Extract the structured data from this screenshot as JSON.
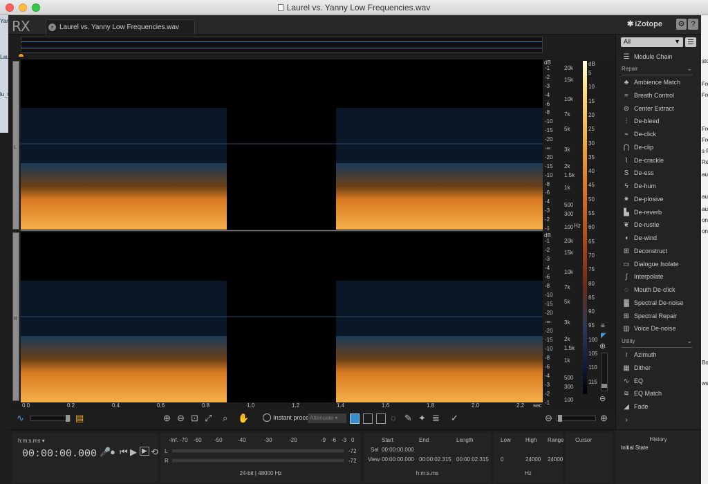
{
  "window": {
    "title": "Laurel vs. Yanny Low Frequencies.wav"
  },
  "app": {
    "logo": "RX",
    "brand": "iZotope",
    "file_tab": "Laurel vs. Yanny Low Frequencies.wav",
    "settings_icon": "gear-icon",
    "help_label": "?"
  },
  "left_strip": [
    "Yan",
    "Lau",
    "lu_wa"
  ],
  "right_strip": [
    "sto",
    "Fre",
    "Fre",
    "Fre",
    "Fre",
    "s R",
    "Re",
    "aur",
    "aur",
    "aur",
    "ony",
    "ony",
    "Bo",
    "ws"
  ],
  "channels": [
    "L",
    "R"
  ],
  "freq_axis": {
    "db_header": "dB",
    "hz_label": "Hz",
    "top": {
      "db": [
        "-1",
        "-2",
        "-3",
        "-4",
        "-6",
        "-8",
        "-10",
        "-15",
        "-20",
        "-∞",
        "-20",
        "-15",
        "-10",
        "-8",
        "-6",
        "-4",
        "-3",
        "-2",
        "-1"
      ],
      "hz": [
        "20k",
        "15k",
        "10k",
        "7k",
        "5k",
        "3k",
        "2k",
        "1.5k",
        "1k",
        "500",
        "300",
        "100"
      ]
    },
    "bottom": {
      "db": [
        "-1",
        "-2",
        "-3",
        "-4",
        "-6",
        "-8",
        "-10",
        "-15",
        "-20",
        "-∞",
        "-20",
        "-15",
        "-10",
        "-8",
        "-6",
        "-4",
        "-3",
        "-2",
        "-1"
      ],
      "hz": [
        "20k",
        "15k",
        "10k",
        "7k",
        "5k",
        "3k",
        "2k",
        "1.5k",
        "1k",
        "500",
        "300",
        "100"
      ]
    }
  },
  "db_scale": {
    "header": "dB",
    "values": [
      "5",
      "10",
      "15",
      "20",
      "25",
      "30",
      "35",
      "40",
      "45",
      "50",
      "55",
      "60",
      "65",
      "70",
      "75",
      "80",
      "85",
      "90",
      "95",
      "100",
      "105",
      "110",
      "115"
    ]
  },
  "time_axis": {
    "unit": "sec",
    "ticks": [
      "0.0",
      "0.2",
      "0.4",
      "0.6",
      "0.8",
      "1.0",
      "1.2",
      "1.4",
      "1.6",
      "1.8",
      "2.0",
      "2.2"
    ]
  },
  "modules": {
    "filter": "All",
    "module_chain": "Module Chain",
    "repair_label": "Repair",
    "repair": [
      {
        "label": "Ambience Match",
        "icon": "tree-icon"
      },
      {
        "label": "Breath Control",
        "icon": "breath-icon"
      },
      {
        "label": "Center Extract",
        "icon": "center-icon"
      },
      {
        "label": "De-bleed",
        "icon": "debleed-icon"
      },
      {
        "label": "De-click",
        "icon": "click-icon"
      },
      {
        "label": "De-clip",
        "icon": "clip-icon"
      },
      {
        "label": "De-crackle",
        "icon": "crackle-icon"
      },
      {
        "label": "De-ess",
        "icon": "ess-icon"
      },
      {
        "label": "De-hum",
        "icon": "hum-icon"
      },
      {
        "label": "De-plosive",
        "icon": "plosive-icon"
      },
      {
        "label": "De-reverb",
        "icon": "reverb-icon"
      },
      {
        "label": "De-rustle",
        "icon": "rustle-icon"
      },
      {
        "label": "De-wind",
        "icon": "wind-icon"
      },
      {
        "label": "Deconstruct",
        "icon": "deconstruct-icon"
      },
      {
        "label": "Dialogue Isolate",
        "icon": "dialogue-icon"
      },
      {
        "label": "Interpolate",
        "icon": "interpolate-icon"
      },
      {
        "label": "Mouth De-click",
        "icon": "mouth-icon"
      },
      {
        "label": "Spectral De-noise",
        "icon": "denoise-icon"
      },
      {
        "label": "Spectral Repair",
        "icon": "spectral-repair-icon"
      },
      {
        "label": "Voice De-noise",
        "icon": "voice-icon"
      }
    ],
    "utility_label": "Utility",
    "utility": [
      {
        "label": "Azimuth",
        "icon": "azimuth-icon"
      },
      {
        "label": "Dither",
        "icon": "dither-icon"
      },
      {
        "label": "EQ",
        "icon": "eq-icon"
      },
      {
        "label": "EQ Match",
        "icon": "eqmatch-icon"
      },
      {
        "label": "Fade",
        "icon": "fade-icon"
      }
    ]
  },
  "toolbar": {
    "instant_process": "Instant process",
    "attenuate": "Attenuate"
  },
  "transport": {
    "format": "h:m:s.ms",
    "timecode": "00:00:00.000"
  },
  "meter": {
    "scale": [
      "-Inf.",
      "-70",
      "-60",
      "-50",
      "-40",
      "-30",
      "-20",
      "-9",
      "-6",
      "-3",
      "0"
    ],
    "left_label": "L",
    "right_label": "R",
    "left_val": "-72",
    "right_val": "-72",
    "format": "24-bit | 48000 Hz"
  },
  "selection": {
    "headers": [
      "Start",
      "End",
      "Length"
    ],
    "sel_label": "Sel",
    "view_label": "View",
    "sel": [
      "00:00:00.000",
      "",
      ""
    ],
    "view": [
      "00:00:00.000",
      "00:00:02.315",
      "00:00:02.315"
    ],
    "format": "h:m:s.ms"
  },
  "freq_range": {
    "headers": [
      "Low",
      "High",
      "Range"
    ],
    "values": [
      "0",
      "24000",
      "24000"
    ],
    "unit": "Hz"
  },
  "cursor": {
    "label": "Cursor"
  },
  "history": {
    "title": "History",
    "items": [
      "Initial State"
    ]
  }
}
